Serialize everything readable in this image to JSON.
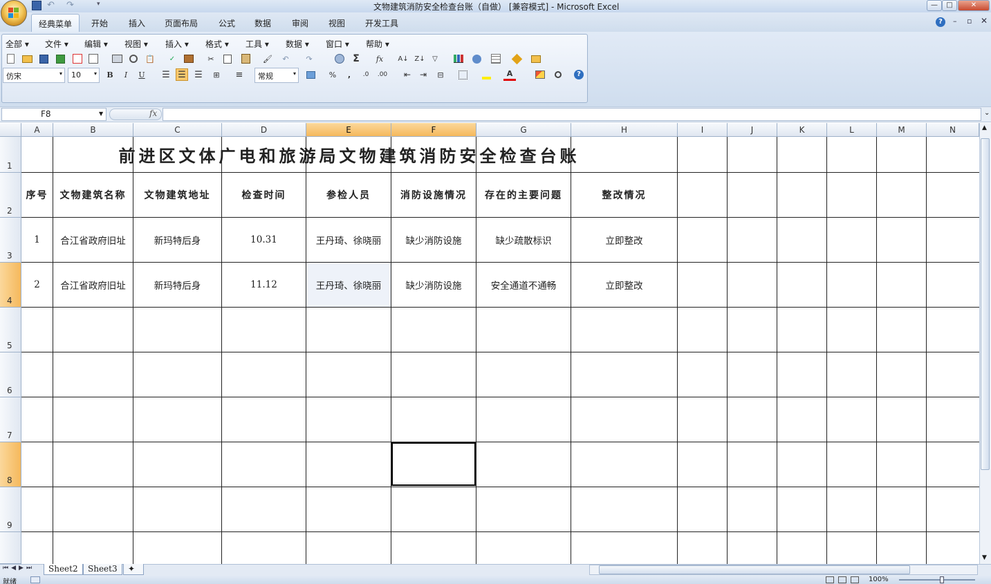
{
  "window": {
    "title": "文物建筑消防安全检查台账（自做） [兼容模式] - Microsoft Excel",
    "controls": [
      "—",
      "□",
      "✕"
    ]
  },
  "ribbon_tabs": [
    "经典菜单",
    "开始",
    "插入",
    "页面布局",
    "公式",
    "数据",
    "审阅",
    "视图",
    "开发工具"
  ],
  "menus": [
    "全部",
    "文件",
    "编辑",
    "视图",
    "插入",
    "格式",
    "工具",
    "数据",
    "窗口",
    "帮助"
  ],
  "format_bar": {
    "font": "仿宋",
    "size": "10",
    "bold": "B",
    "italic": "I",
    "underline": "U",
    "number_format": "常规",
    "percent": "%",
    "comma": ","
  },
  "formula_bar": {
    "name_box": "F8",
    "fx": "fx",
    "content": ""
  },
  "columns": [
    "A",
    "B",
    "C",
    "D",
    "E",
    "F",
    "G",
    "H",
    "I",
    "J",
    "K",
    "L",
    "M",
    "N"
  ],
  "rows": [
    "1",
    "2",
    "3",
    "4",
    "5",
    "6",
    "7",
    "8",
    "9"
  ],
  "sheet": {
    "title": "前进区文体广电和旅游局文物建筑消防安全检查台账",
    "headers": [
      "序号",
      "文物建筑名称",
      "文物建筑地址",
      "检查时间",
      "参检人员",
      "消防设施情况",
      "存在的主要问题",
      "整改情况"
    ],
    "records": [
      [
        "1",
        "合江省政府旧址",
        "新玛特后身",
        "10.31",
        "王丹琦、徐晓丽",
        "缺少消防设施",
        "缺少疏散标识",
        "立即整改"
      ],
      [
        "2",
        "合江省政府旧址",
        "新玛特后身",
        "11.12",
        "王丹琦、徐晓丽",
        "缺少消防设施",
        "安全通道不通畅",
        "立即整改"
      ]
    ]
  },
  "sheet_tabs": [
    "Sheet2",
    "Sheet3"
  ],
  "status": {
    "ready": "就绪",
    "zoom": "100%"
  }
}
